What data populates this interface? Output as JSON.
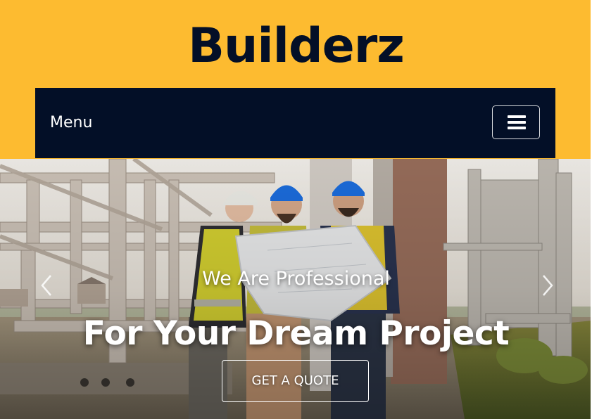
{
  "brand": {
    "name": "Builderz"
  },
  "nav": {
    "menu_label": "Menu",
    "toggler_icon": "hamburger-icon"
  },
  "hero": {
    "subtitle": "We Are Professional",
    "title": "For Your Dream Project",
    "cta_label": "GET A QUOTE",
    "prev_icon": "chevron-left-icon",
    "next_icon": "chevron-right-icon"
  },
  "colors": {
    "accent": "#fdbb30",
    "dark": "#030f27",
    "text_light": "#ffffff"
  }
}
